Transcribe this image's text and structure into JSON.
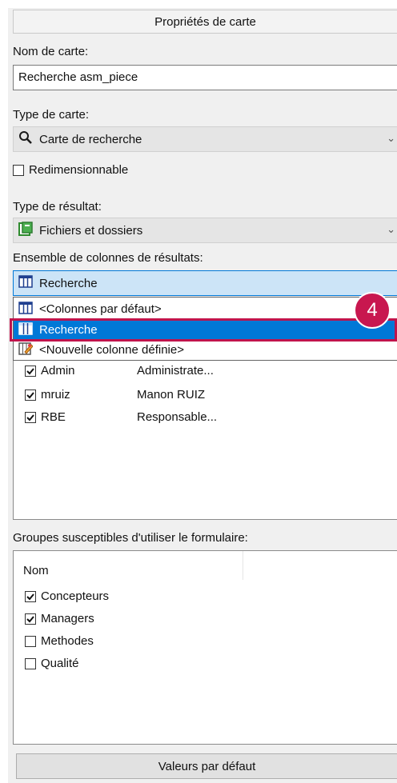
{
  "window_title": "Propriétés de carte",
  "card_name": {
    "label": "Nom de carte:",
    "value": "Recherche asm_piece"
  },
  "card_type": {
    "label": "Type de carte:",
    "value": "Carte de recherche",
    "icon": "search-icon"
  },
  "resizable": {
    "label": "Redimensionnable",
    "checked": false
  },
  "result_type": {
    "label": "Type de résultat:",
    "value": "Fichiers et dossiers",
    "icon": "files-folders-icon"
  },
  "column_set": {
    "label": "Ensemble de colonnes de résultats:",
    "value": "Recherche",
    "options": [
      {
        "label": "<Colonnes par défaut>",
        "selected": false
      },
      {
        "label": "Recherche",
        "selected": true
      },
      {
        "label": "<Nouvelle colonne définie>",
        "selected": false
      }
    ]
  },
  "callout_badge": "4",
  "users": [
    {
      "login": "Admin",
      "name": "Administrate...",
      "checked": true
    },
    {
      "login": "mruiz",
      "name": "Manon RUIZ",
      "checked": true
    },
    {
      "login": "RBE",
      "name": "Responsable...",
      "checked": true
    }
  ],
  "groups": {
    "label": "Groupes susceptibles d'utiliser le formulaire:",
    "column_header": "Nom",
    "items": [
      {
        "name": "Concepteurs",
        "checked": true
      },
      {
        "name": "Managers",
        "checked": true
      },
      {
        "name": "Methodes",
        "checked": false
      },
      {
        "name": "Qualité",
        "checked": false
      }
    ]
  },
  "default_button": "Valeurs par défaut",
  "colors": {
    "accent": "#0078d7",
    "badge": "#c8174f",
    "selected_text": "#ffffff"
  }
}
